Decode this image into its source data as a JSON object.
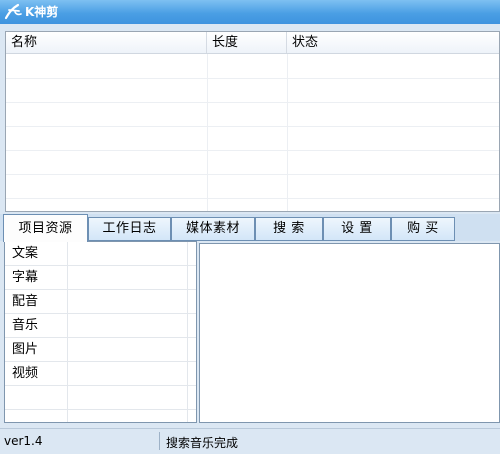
{
  "window": {
    "title": "K神剪",
    "logo_icon": "calligraphy-k-logo-icon"
  },
  "file_list": {
    "columns": [
      "名称",
      "长度",
      "状态"
    ],
    "rows": []
  },
  "tabs": [
    {
      "label": "项目资源",
      "active": true
    },
    {
      "label": "工作日志",
      "active": false
    },
    {
      "label": "媒体素材",
      "active": false
    },
    {
      "label": "搜 索",
      "active": false
    },
    {
      "label": "设 置",
      "active": false
    },
    {
      "label": "购 买",
      "active": false
    }
  ],
  "resources": {
    "items": [
      "文案",
      "字幕",
      "配音",
      "音乐",
      "图片",
      "视频"
    ]
  },
  "status": {
    "version": "ver1.4",
    "message": "搜索音乐完成"
  },
  "colors": {
    "titlebar": "#4b9fe4",
    "window_bg": "#dbe7f3",
    "tab_border": "#6d8fb3"
  }
}
